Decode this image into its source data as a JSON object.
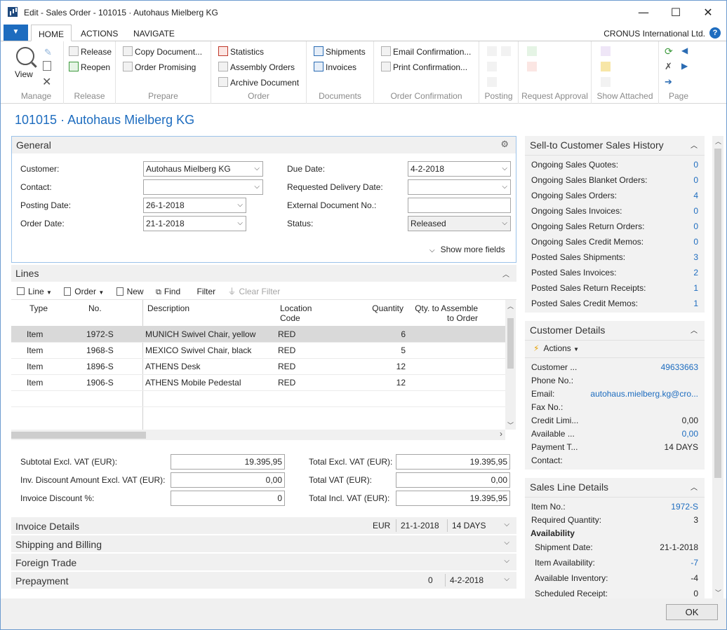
{
  "window": {
    "title": "Edit - Sales Order - 101015 · Autohaus Mielberg KG",
    "minimize_glyph": "—",
    "maximize_glyph": "☐",
    "close_glyph": "✕"
  },
  "ribbon_tabs": {
    "file_glyph": "▼",
    "tabs": [
      "HOME",
      "ACTIONS",
      "NAVIGATE"
    ],
    "company": "CRONUS International Ltd.",
    "help_glyph": "?"
  },
  "ribbon": {
    "groups": [
      "Manage",
      "Release",
      "Prepare",
      "Order",
      "Documents",
      "Order Confirmation",
      "Posting",
      "Request Approval",
      "Show Attached",
      "Page"
    ],
    "manage": {
      "view": "View"
    },
    "release": {
      "release": "Release",
      "reopen": "Reopen"
    },
    "prepare": {
      "copy_document": "Copy Document...",
      "order_promising": "Order Promising"
    },
    "order": {
      "statistics": "Statistics",
      "assembly_orders": "Assembly Orders",
      "archive_document": "Archive Document"
    },
    "documents": {
      "shipments": "Shipments",
      "invoices": "Invoices"
    },
    "order_confirmation": {
      "email_confirmation": "Email Confirmation...",
      "print_confirmation": "Print Confirmation..."
    }
  },
  "page_title": "101015 · Autohaus Mielberg KG",
  "general": {
    "header": "General",
    "customer_label": "Customer:",
    "customer_value": "Autohaus Mielberg KG",
    "contact_label": "Contact:",
    "contact_value": "",
    "posting_date_label": "Posting Date:",
    "posting_date_value": "26-1-2018",
    "order_date_label": "Order Date:",
    "order_date_value": "21-1-2018",
    "due_date_label": "Due Date:",
    "due_date_value": "4-2-2018",
    "requested_delivery_label": "Requested Delivery Date:",
    "requested_delivery_value": "",
    "external_doc_label": "External Document No.:",
    "external_doc_value": "",
    "status_label": "Status:",
    "status_value": "Released",
    "show_more": "Show more fields"
  },
  "lines": {
    "header": "Lines",
    "toolbar": {
      "line": "Line",
      "order": "Order",
      "new": "New",
      "find": "Find",
      "filter": "Filter",
      "clear_filter": "Clear Filter"
    },
    "columns": {
      "type": "Type",
      "no": "No.",
      "description": "Description",
      "location_1": "Location",
      "location_2": "Code",
      "quantity": "Quantity",
      "qty_assemble_1": "Qty. to Assemble",
      "qty_assemble_2": "to Order"
    },
    "rows": [
      {
        "type": "Item",
        "no": "1972-S",
        "description": "MUNICH Swivel Chair, yellow",
        "location": "RED",
        "quantity": "6"
      },
      {
        "type": "Item",
        "no": "1968-S",
        "description": "MEXICO Swivel Chair, black",
        "location": "RED",
        "quantity": "5"
      },
      {
        "type": "Item",
        "no": "1896-S",
        "description": "ATHENS Desk",
        "location": "RED",
        "quantity": "12"
      },
      {
        "type": "Item",
        "no": "1906-S",
        "description": "ATHENS Mobile Pedestal",
        "location": "RED",
        "quantity": "12"
      }
    ]
  },
  "totals": {
    "subtotal_label": "Subtotal Excl. VAT (EUR):",
    "subtotal_value": "19.395,95",
    "inv_discount_amount_label": "Inv. Discount Amount Excl. VAT (EUR):",
    "inv_discount_amount_value": "0,00",
    "invoice_discount_pct_label": "Invoice Discount %:",
    "invoice_discount_pct_value": "0",
    "total_excl_label": "Total Excl. VAT (EUR):",
    "total_excl_value": "19.395,95",
    "total_vat_label": "Total VAT (EUR):",
    "total_vat_value": "0,00",
    "total_incl_label": "Total Incl. VAT (EUR):",
    "total_incl_value": "19.395,95"
  },
  "collapsed_tabs": {
    "invoice_details": "Invoice Details",
    "invoice_currency": "EUR",
    "invoice_date": "21-1-2018",
    "invoice_terms": "14 DAYS",
    "shipping_billing": "Shipping and Billing",
    "foreign_trade": "Foreign Trade",
    "prepayment": "Prepayment",
    "prepayment_pct": "0",
    "prepayment_due": "4-2-2018"
  },
  "sales_history": {
    "header": "Sell-to Customer Sales History",
    "rows": [
      {
        "label": "Ongoing Sales Quotes:",
        "value": "0"
      },
      {
        "label": "Ongoing Sales Blanket Orders:",
        "value": "0"
      },
      {
        "label": "Ongoing Sales Orders:",
        "value": "4"
      },
      {
        "label": "Ongoing Sales Invoices:",
        "value": "0"
      },
      {
        "label": "Ongoing Sales Return Orders:",
        "value": "0"
      },
      {
        "label": "Ongoing Sales Credit Memos:",
        "value": "0"
      },
      {
        "label": "Posted Sales Shipments:",
        "value": "3"
      },
      {
        "label": "Posted Sales Invoices:",
        "value": "2"
      },
      {
        "label": "Posted Sales Return Receipts:",
        "value": "1"
      },
      {
        "label": "Posted Sales Credit Memos:",
        "value": "1"
      }
    ]
  },
  "customer_details": {
    "header": "Customer Details",
    "actions": "Actions",
    "customer_label": "Customer ...",
    "customer_value": "49633663",
    "phone_label": "Phone No.:",
    "email_label": "Email:",
    "email_value": "autohaus.mielberg.kg@cro...",
    "fax_label": "Fax No.:",
    "credit_limit_label": "Credit Limi...",
    "credit_limit_value": "0,00",
    "available_label": "Available ...",
    "available_value": "0,00",
    "payment_terms_label": "Payment T...",
    "payment_terms_value": "14 DAYS",
    "contact_label": "Contact:"
  },
  "sales_line_details": {
    "header": "Sales Line Details",
    "item_no_label": "Item No.:",
    "item_no_value": "1972-S",
    "required_qty_label": "Required Quantity:",
    "required_qty_value": "3",
    "availability_label": "Availability",
    "shipment_date_label": "Shipment Date:",
    "shipment_date_value": "21-1-2018",
    "item_availability_label": "Item Availability:",
    "item_availability_value": "-7",
    "available_inventory_label": "Available Inventory:",
    "available_inventory_value": "-4",
    "scheduled_receipt_label": "Scheduled Receipt:",
    "scheduled_receipt_value": "0"
  },
  "ok_button": "OK"
}
